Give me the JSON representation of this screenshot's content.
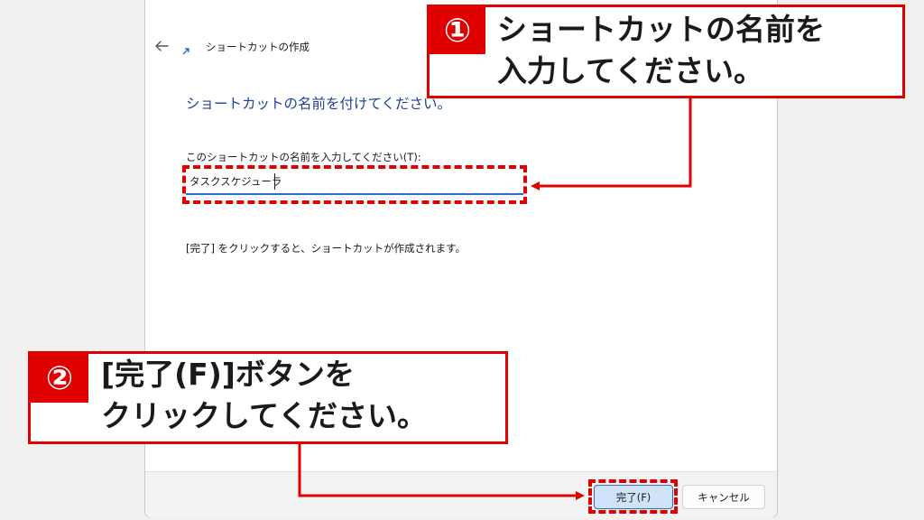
{
  "wizard": {
    "title": "ショートカットの作成",
    "heading": "ショートカットの名前を付けてください。",
    "field_label": "このショートカットの名前を入力してください(T):",
    "name_value": "タスクスケジューラ",
    "hint": "[完了] をクリックすると、ショートカットが作成されます。",
    "finish_label": "完了(F)",
    "cancel_label": "キャンセル"
  },
  "annotations": {
    "step1": {
      "badge": "①",
      "line1": "ショートカットの名前を",
      "line2": "入力してください。"
    },
    "step2": {
      "badge": "②",
      "line1": "[完了(F)]ボタンを",
      "line2": "クリックしてください。"
    },
    "color": "#e00000"
  },
  "icons": {
    "back": "back-arrow-icon",
    "shortcut": "shortcut-arrow-icon"
  }
}
